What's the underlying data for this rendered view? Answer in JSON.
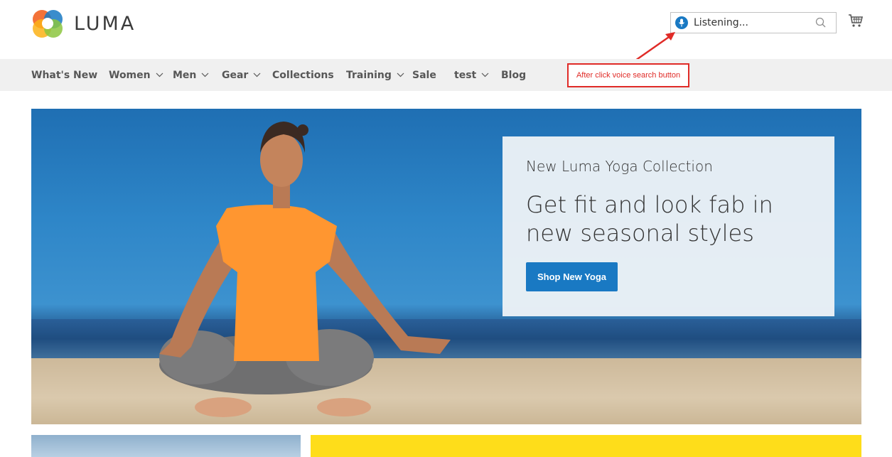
{
  "brand": {
    "name": "LUMA",
    "logo_icon": "luma-logo-icon"
  },
  "search": {
    "status_text": "Listening...",
    "mic_icon": "microphone-icon",
    "search_icon": "magnifier-icon"
  },
  "cart": {
    "icon": "cart-icon"
  },
  "annotation": {
    "text": "After click voice search button",
    "color": "#e02b27"
  },
  "nav": {
    "items": [
      {
        "label": "What's New",
        "has_dropdown": false
      },
      {
        "label": "Women",
        "has_dropdown": true
      },
      {
        "label": "Men",
        "has_dropdown": true
      },
      {
        "label": "Gear",
        "has_dropdown": true
      },
      {
        "label": "Collections",
        "has_dropdown": false
      },
      {
        "label": "Training",
        "has_dropdown": true
      },
      {
        "label": "Sale",
        "has_dropdown": false
      },
      {
        "label": "test",
        "has_dropdown": true
      },
      {
        "label": "Blog",
        "has_dropdown": false
      }
    ]
  },
  "hero": {
    "eyebrow": "New Luma Yoga Collection",
    "headline": "Get fit and look fab in new seasonal styles",
    "cta_label": "Shop New Yoga"
  },
  "colors": {
    "accent": "#1979c3",
    "nav_bg": "#f0f0f0",
    "tile_yellow": "#fedd1a"
  }
}
